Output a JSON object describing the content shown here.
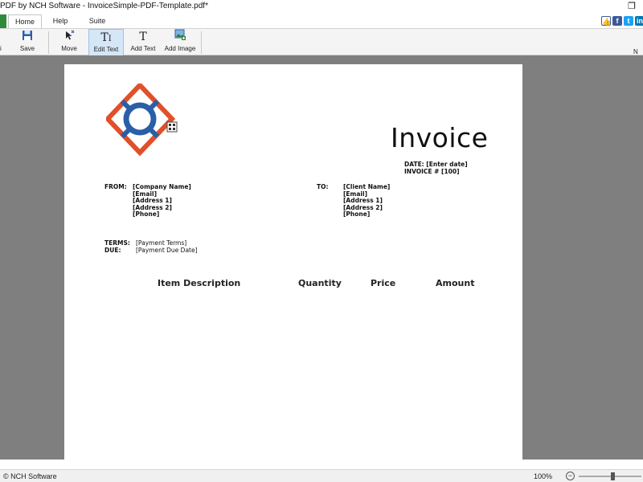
{
  "window": {
    "title": "PDF by NCH Software - InvoiceSimple-PDF-Template.pdf*",
    "restore_glyph": "❐"
  },
  "tabs": [
    {
      "label": "Home",
      "active": true
    },
    {
      "label": "Help",
      "active": false
    },
    {
      "label": "Suite",
      "active": false
    }
  ],
  "social": {
    "like_glyph": "👍",
    "facebook_glyph": "f",
    "twitter_glyph": "t",
    "linkedin_glyph": "in",
    "colors": {
      "facebook": "#3b5998",
      "twitter": "#1da1f2",
      "linkedin": "#0077b5"
    }
  },
  "toolbar": {
    "left_stub": "i",
    "right_stub": "N",
    "tools": [
      {
        "label": "Save",
        "icon": "floppy-disk-icon"
      },
      {
        "label": "Move",
        "icon": "move-cursor-icon"
      },
      {
        "label": "Edit Text",
        "icon": "edit-text-icon",
        "active": true
      },
      {
        "label": "Add Text",
        "icon": "add-text-icon"
      },
      {
        "label": "Add Image",
        "icon": "add-image-icon"
      }
    ]
  },
  "document": {
    "heading": "Invoice",
    "date_line": "DATE: [Enter date]",
    "invoice_num_line": "INVOICE # [100]",
    "from_label": "FROM:",
    "from_lines": [
      "[Company Name]",
      "[Email]",
      "[Address 1]",
      "[Address 2]",
      "[Phone]"
    ],
    "to_label": "TO:",
    "to_lines": [
      "[Client Name]",
      "[Email]",
      "[Address 1]",
      "[Address 2]",
      "[Phone]"
    ],
    "terms_label": "TERMS:",
    "terms_value": "[Payment Terms]",
    "due_label": "DUE:",
    "due_value": "[Payment Due Date]",
    "columns": [
      "Item Description",
      "Quantity",
      "Price",
      "Amount"
    ],
    "logo_colors": {
      "outer": "#e0502a",
      "inner": "#2a5fa8"
    }
  },
  "status": {
    "copyright": "© NCH Software",
    "zoom": "100%",
    "zoom_out_glyph": "−",
    "zoom_fraction": 0.55
  }
}
